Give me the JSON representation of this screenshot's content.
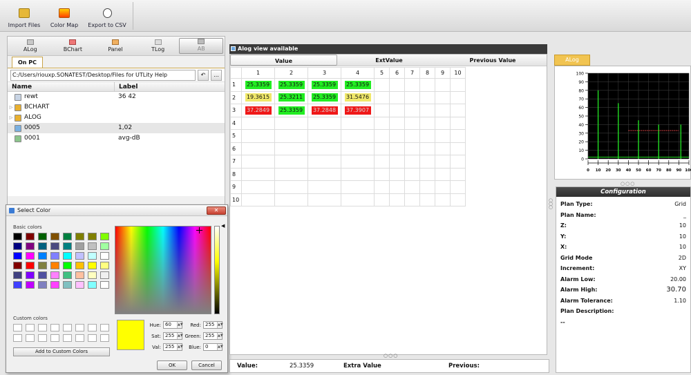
{
  "toolbar": {
    "import_label": "Import Files",
    "colormap_label": "Color Map",
    "export_label": "Export to CSV"
  },
  "views": [
    {
      "label": "ALog"
    },
    {
      "label": "BChart"
    },
    {
      "label": "Panel"
    },
    {
      "label": "TLog"
    },
    {
      "label": "AB"
    }
  ],
  "explorer": {
    "tab": "On PC",
    "path": "C:/Users/riouxp.SONATEST/Desktop/Files for UTLity Help",
    "back_glyph": "↶",
    "more_label": "...",
    "col_name": "Name",
    "col_label": "Label",
    "rows": [
      {
        "name": "rewt",
        "label": "36 42",
        "type": "file",
        "expand": ""
      },
      {
        "name": "BCHART",
        "label": "",
        "type": "folder",
        "expand": "▷"
      },
      {
        "name": "ALOG",
        "label": "",
        "type": "folder",
        "expand": "▷"
      },
      {
        "name": "0005",
        "label": "1,02",
        "type": "grid",
        "expand": ""
      },
      {
        "name": "0001",
        "label": "avg-dB",
        "type": "chart",
        "expand": ""
      }
    ]
  },
  "dialog": {
    "title": "Select Color",
    "close_glyph": "✕",
    "basic_colors_label": "Basic colors",
    "custom_colors_label": "Custom colors",
    "add_custom_label": "Add to Custom Colors",
    "basic_colors": [
      "#000000",
      "#7f0000",
      "#006000",
      "#7f5000",
      "#008040",
      "#7f7f00",
      "#808000",
      "#80ff00",
      "#000080",
      "#800080",
      "#00607f",
      "#4a4a7f",
      "#008080",
      "#a0a0a0",
      "#c0c0c0",
      "#a0ffa0",
      "#0000ff",
      "#ff00ff",
      "#0080ff",
      "#8080ff",
      "#00ffff",
      "#c0c0ff",
      "#c0ffff",
      "#ffffff",
      "#800000",
      "#ff0000",
      "#808040",
      "#ff8000",
      "#00ff00",
      "#ffc000",
      "#ffff00",
      "#ffff80",
      "#404080",
      "#8000ff",
      "#5050a0",
      "#ff80ff",
      "#40c080",
      "#ffc0a0",
      "#ffffc0",
      "#f0f0f0",
      "#4040ff",
      "#c000ff",
      "#8080c0",
      "#ff40ff",
      "#80c0c0",
      "#ffc0ff",
      "#80ffff",
      "#ffffff"
    ],
    "hue_label": "Hue:",
    "hue": "60",
    "sat_label": "Sat:",
    "sat": "255",
    "val_label": "Val:",
    "val": "255",
    "red_label": "Red:",
    "red": "255",
    "green_label": "Green:",
    "green": "255",
    "blue_label": "Blue:",
    "blue": "0",
    "selected_color": "#ffff00",
    "ok_label": "OK",
    "cancel_label": "Cancel"
  },
  "center": {
    "banner": "Alog view available",
    "col_value": "Value",
    "col_extvalue": "ExtValue",
    "col_previous": "Previous Value",
    "columns": [
      "1",
      "2",
      "3",
      "4",
      "5",
      "6",
      "7",
      "8",
      "9",
      "10"
    ],
    "rows": [
      "1",
      "2",
      "3",
      "4",
      "5",
      "6",
      "7",
      "8",
      "9",
      "10"
    ],
    "cells": [
      [
        {
          "v": "25.3359",
          "c": "g"
        },
        {
          "v": "25.3359",
          "c": "g"
        },
        {
          "v": "25.3359",
          "c": "g"
        },
        {
          "v": "25.3359",
          "c": "g"
        }
      ],
      [
        {
          "v": "19.3615",
          "c": "y"
        },
        {
          "v": "25.3211",
          "c": "g"
        },
        {
          "v": "25.3359",
          "c": "g"
        },
        {
          "v": "31.5476",
          "c": "y"
        }
      ],
      [
        {
          "v": "37.2849",
          "c": "r"
        },
        {
          "v": "25.3359",
          "c": "g"
        },
        {
          "v": "37.2848",
          "c": "r"
        },
        {
          "v": "37.3907",
          "c": "r"
        }
      ]
    ],
    "grip": "○○○"
  },
  "bottom": {
    "value_label": "Value:",
    "value": "25.3359",
    "extra_label": "Extra Value",
    "previous_label": "Previous:"
  },
  "right": {
    "tab": "ALog",
    "grip": "○○○",
    "config_title": "Configuration",
    "config": [
      {
        "k": "Plan Type:",
        "v": "Grid"
      },
      {
        "k": "Plan Name:",
        "v": "_"
      },
      {
        "k": "Z:",
        "v": "10"
      },
      {
        "k": "Y:",
        "v": "10"
      },
      {
        "k": "X:",
        "v": "10"
      },
      {
        "k": "Grid Mode",
        "v": "2D"
      },
      {
        "k": "Increment:",
        "v": "XY"
      },
      {
        "k": "Alarm Low:",
        "v": "20.00"
      },
      {
        "k": "Alarm High:",
        "v": "30.70",
        "big": true
      },
      {
        "k": "Alarm Tolerance:",
        "v": "1.10"
      },
      {
        "k": "Plan Description:",
        "v": ""
      },
      {
        "k": "--",
        "v": ""
      }
    ]
  },
  "chart_data": {
    "type": "bar",
    "yticks": [
      "100",
      "90",
      "80",
      "70",
      "60",
      "50",
      "40",
      "30",
      "20",
      "10",
      "0"
    ],
    "xticks": [
      "0",
      "10",
      "20",
      "30",
      "40",
      "50",
      "60",
      "70",
      "80",
      "90",
      "100"
    ],
    "x": [
      10,
      30,
      50,
      70,
      92
    ],
    "values": [
      80,
      65,
      45,
      40,
      40
    ],
    "xlim": [
      0,
      100
    ],
    "ylim": [
      0,
      100
    ],
    "gate_y": 33,
    "gate_x": [
      40,
      90
    ],
    "grid": true,
    "background": "#000000",
    "trace_color": "#22dd22"
  }
}
